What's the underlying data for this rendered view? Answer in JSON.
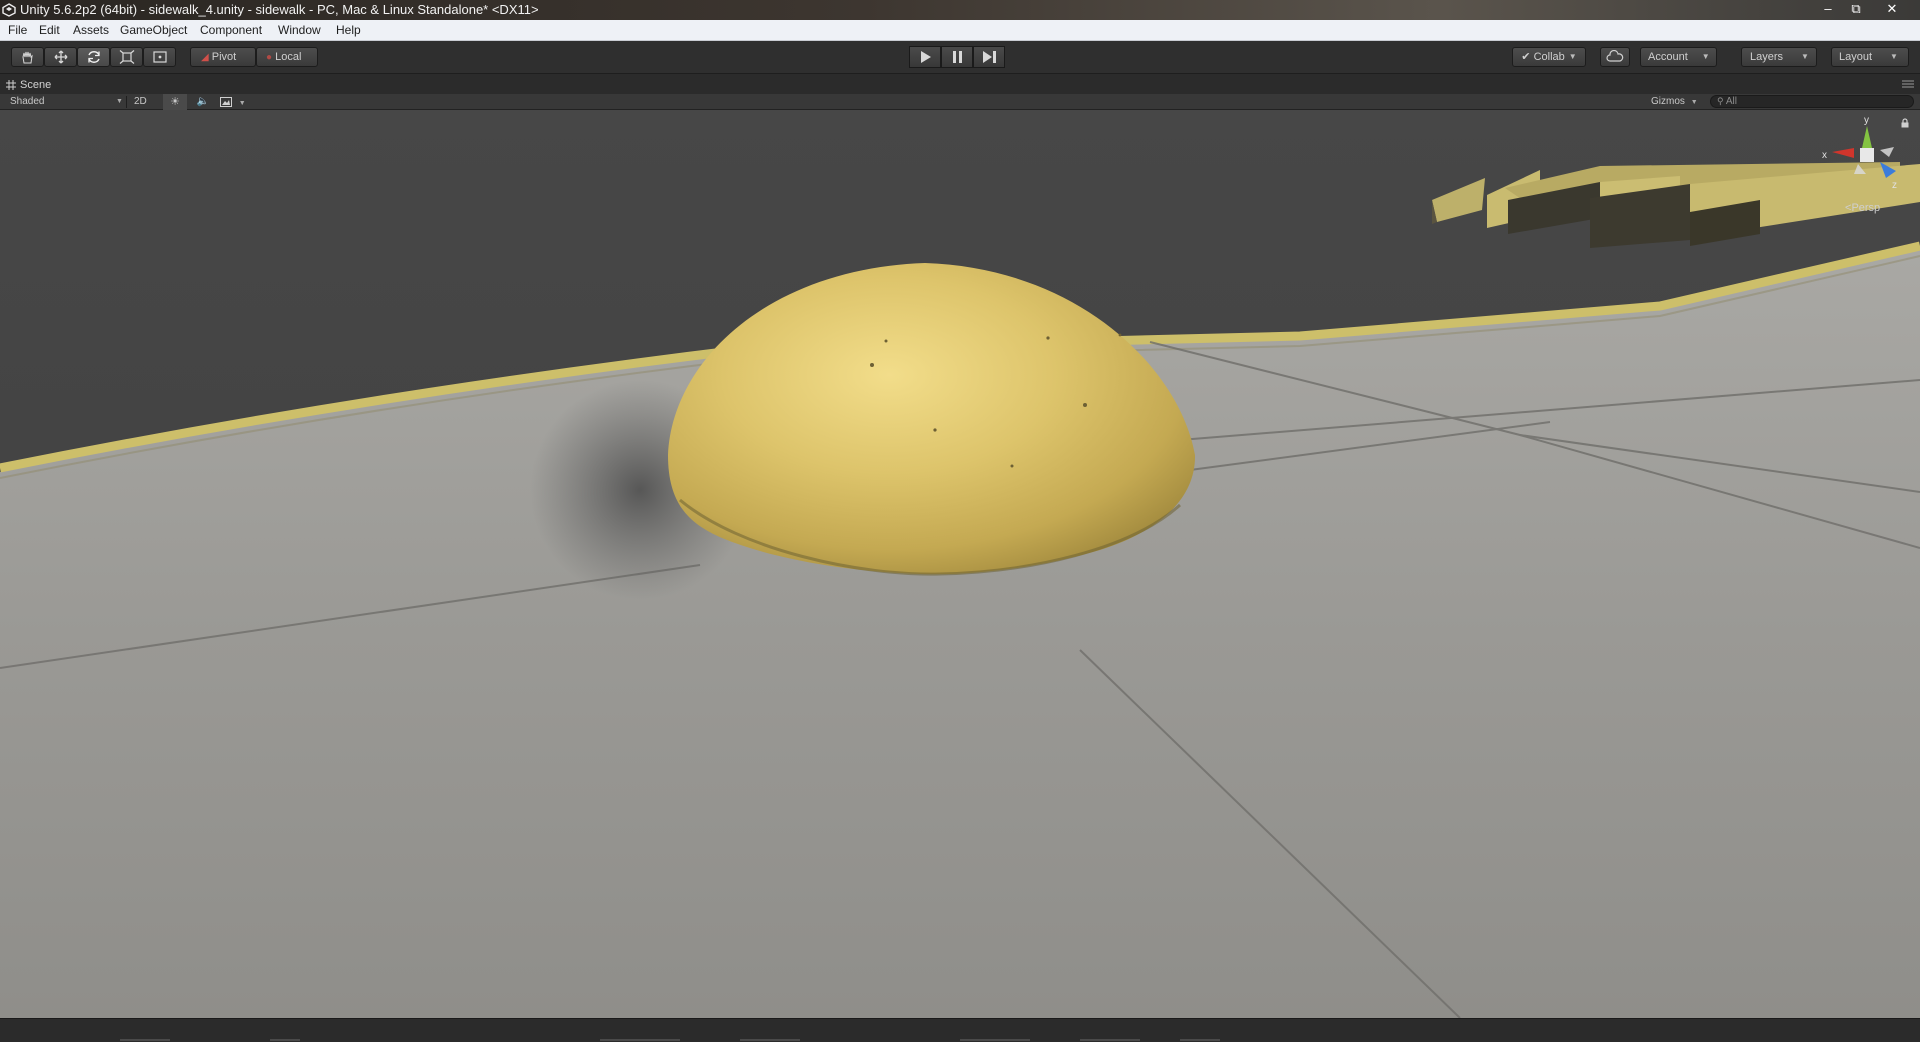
{
  "window": {
    "title": "Unity 5.6.2p2 (64bit) - sidewalk_4.unity - sidewalk - PC, Mac & Linux Standalone* <DX11>",
    "minimize_glyph": "–",
    "maximize_glyph": "⧉",
    "close_glyph": "✕"
  },
  "menu": [
    "File",
    "Edit",
    "Assets",
    "GameObject",
    "Component",
    "Window",
    "Help"
  ],
  "toolbar": {
    "transform_tools": [
      "hand-tool-icon",
      "move-tool-icon",
      "rotate-tool-icon",
      "scale-tool-icon",
      "rect-tool-icon"
    ],
    "active_tool": "rotate-tool-icon",
    "pivot_label": "Pivot",
    "local_label": "Local",
    "playback": [
      "play-icon",
      "pause-icon",
      "step-icon"
    ],
    "collab_label": "Collab",
    "account_label": "Account",
    "layers_label": "Layers",
    "layout_label": "Layout"
  },
  "scene": {
    "tab_label": "Scene",
    "shading_mode": "Shaded",
    "mode_2d_label": "2D",
    "gizmos_label": "Gizmos",
    "search_placeholder": "All",
    "projection_label": "Persp",
    "axis_labels": {
      "x": "x",
      "y": "y",
      "z": "z"
    }
  },
  "colors": {
    "unity_dark": "#383838",
    "bollard_yellow": "#d9c26a",
    "pavement_gray": "#9b9b97",
    "axis_x": "#d0352c",
    "axis_y": "#83c341",
    "axis_z": "#3b7cdb"
  }
}
